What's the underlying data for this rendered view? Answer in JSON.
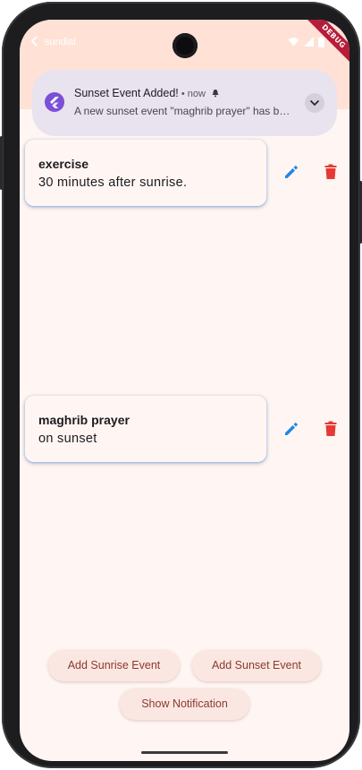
{
  "status_bar": {
    "app_name": "sundial",
    "debug_label": "DEBUG"
  },
  "notification": {
    "title": "Sunset Event Added!",
    "meta": " • now",
    "body": "A new sunset event \"maghrib prayer\" has been added.",
    "app_icon": "flutter-icon",
    "accent": "#7b4fd6"
  },
  "events": [
    {
      "title": "exercise",
      "description": "30 minutes after sunrise."
    },
    {
      "title": "maghrib prayer",
      "description": "on sunset"
    }
  ],
  "actions": {
    "edit_icon": "pencil-icon",
    "delete_icon": "trash-icon",
    "edit_color": "#1e88e5",
    "delete_color": "#e53935"
  },
  "buttons": {
    "add_sunrise": "Add Sunrise Event",
    "add_sunset": "Add Sunset Event",
    "show_notification": "Show Notification"
  }
}
